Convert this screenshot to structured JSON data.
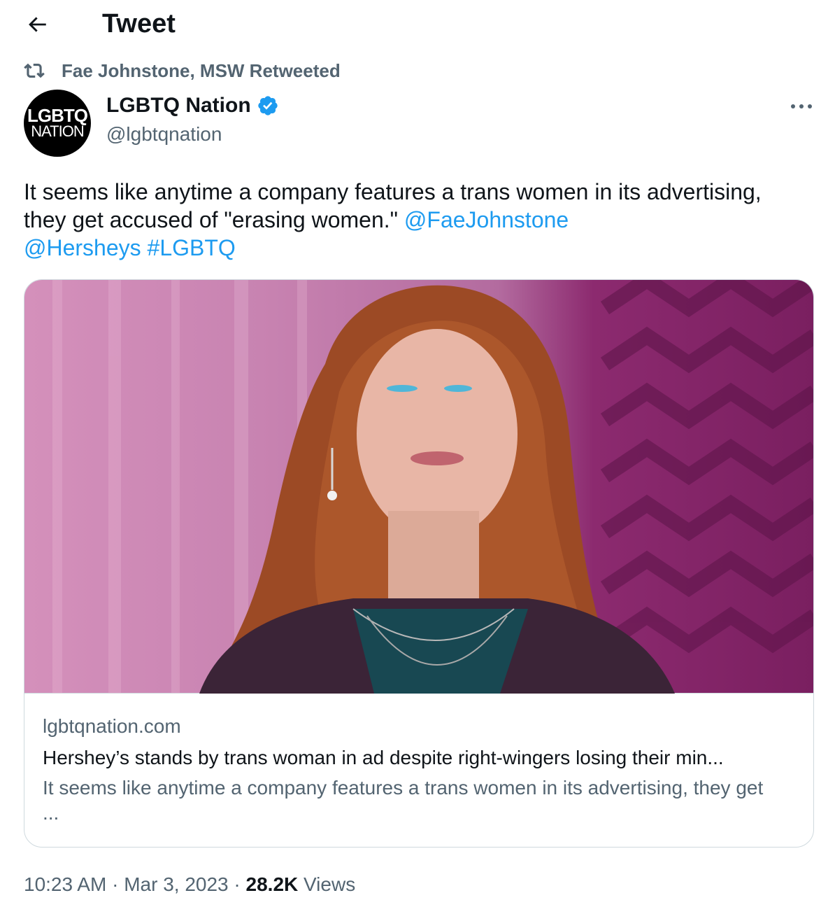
{
  "header": {
    "back_icon": "arrow-left-icon",
    "title": "Tweet"
  },
  "retweet": {
    "icon": "retweet-icon",
    "label": "Fae Johnstone, MSW Retweeted"
  },
  "author": {
    "avatar_line1": "LGBTQ",
    "avatar_line2": "NATION",
    "name": "LGBTQ Nation",
    "verified_icon": "verified-badge-icon",
    "handle": "@lgbtqnation",
    "verified_color": "#1d9bf0"
  },
  "more_icon": "more-horizontal-icon",
  "tweet": {
    "text": "It seems like anytime a company features a trans women in its advertising, they get accused of \"erasing women.\" ",
    "mention1": "@FaeJohnstone",
    "mention2": "@Hersheys",
    "hashtag": "#LGBTQ",
    "link_color": "#1d9bf0"
  },
  "card": {
    "domain": "lgbtqnation.com",
    "title": "Hershey’s stands by trans woman in ad despite right-wingers losing their min...",
    "description": "It seems like anytime a company features a trans women in its advertising, they get ..."
  },
  "meta": {
    "time": "10:23 AM",
    "separator": " · ",
    "date": "Mar 3, 2023",
    "views_count": "28.2K",
    "views_label": " Views"
  }
}
